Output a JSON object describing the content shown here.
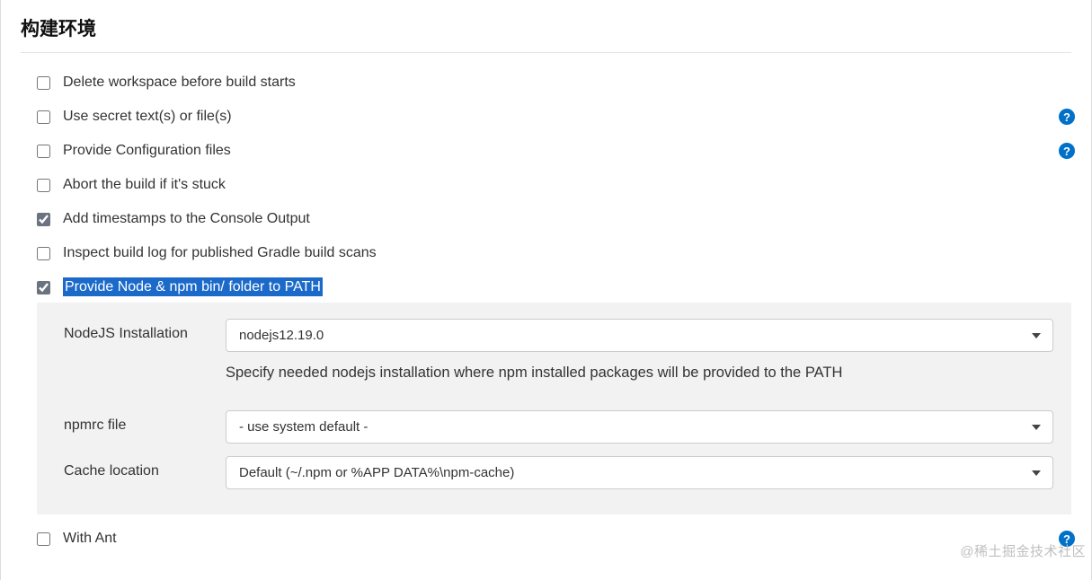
{
  "section": {
    "title": "构建环境"
  },
  "options": {
    "delete_workspace": {
      "label": "Delete workspace before build starts",
      "checked": false,
      "help": false
    },
    "use_secret": {
      "label": "Use secret text(s) or file(s)",
      "checked": false,
      "help": true
    },
    "provide_config": {
      "label": "Provide Configuration files",
      "checked": false,
      "help": true
    },
    "abort_stuck": {
      "label": "Abort the build if it's stuck",
      "checked": false,
      "help": false
    },
    "add_timestamps": {
      "label": "Add timestamps to the Console Output",
      "checked": true,
      "help": false
    },
    "inspect_gradle": {
      "label": "Inspect build log for published Gradle build scans",
      "checked": false,
      "help": false
    },
    "provide_node": {
      "label": "Provide Node & npm bin/ folder to PATH",
      "checked": true,
      "help": false
    },
    "with_ant": {
      "label": "With Ant",
      "checked": false,
      "help": true
    }
  },
  "node_panel": {
    "nodejs_installation": {
      "label": "NodeJS Installation",
      "value": "nodejs12.19.0",
      "help": "Specify needed nodejs installation where npm installed packages will be provided to the PATH"
    },
    "npmrc_file": {
      "label": "npmrc file",
      "value": "- use system default -"
    },
    "cache_location": {
      "label": "Cache location",
      "value": "Default (~/.npm or %APP DATA%\\npm-cache)"
    }
  },
  "watermark": "@稀土掘金技术社区"
}
